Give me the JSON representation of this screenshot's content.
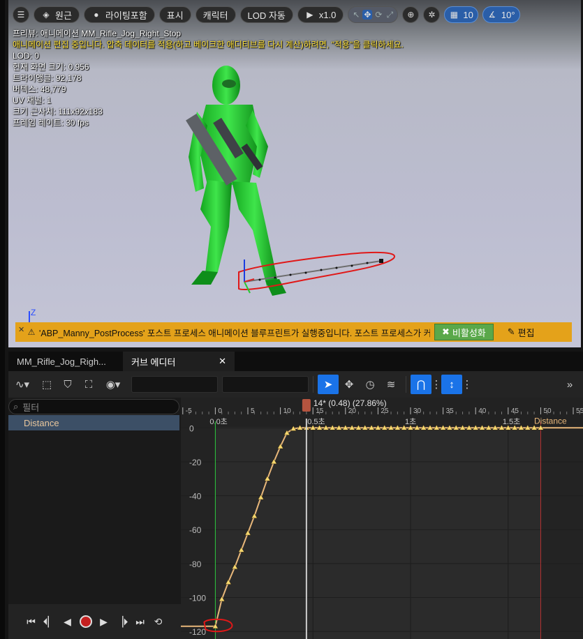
{
  "viewport": {
    "toolbar": {
      "menu_icon": "hamburger-icon",
      "perspective_label": "원근",
      "lighting_label": "라이팅포함",
      "show_label": "표시",
      "character_label": "캐릭터",
      "lod_label": "LOD 자동",
      "speed_label": "x1.0",
      "grid_value": "10",
      "angle_value": "10°"
    },
    "info": {
      "preview": "프리뷰: 애니메이션 MM_Rifle_Jog_Right_Stop",
      "editing_warning": "애니메이션 편집 중입니다. 압축 데이터를 적용(하고 베이크한 애디티브를 다시 계산)하려면, \"적용\"을 클릭하세요.",
      "lod": "LOD: 0",
      "screen_size": "현재 화면 크기: 0.956",
      "triangles": "트라이앵글: 92,178",
      "vertices": "버텍스: 48,779",
      "uv_channels": "UV 채널: 1",
      "approx_size": "크기 근사치: 111x92x183",
      "frame_rate": "프레임 레이트: 30 fps"
    },
    "axis_label": "Z",
    "warning_bar": {
      "close": "✕",
      "text": "'ABP_Manny_PostProcess' 포스트 프로세스 애니메이션 블루프린트가 실행중입니다. 포스트 프로세스가 커",
      "disable_label": "비활성화",
      "edit_label": "편집"
    }
  },
  "tabs": {
    "anim_tab": "MM_Rifle_Jog_Righ...",
    "curve_tab": "커브 에디터",
    "curve_close": "✕"
  },
  "left_panel": {
    "filter_placeholder": "필터",
    "curve_name": "Distance"
  },
  "colors": {
    "accent": "#1a73e8",
    "curve": "#e8b77a",
    "key": "#f5d76e",
    "playhead": "#cccccc",
    "start_marker": "#2ecc40",
    "end_marker": "#b83232",
    "warning": "#e4a21a",
    "annotation": "#e01818"
  },
  "chart_data": {
    "type": "line",
    "frame_ticks": [
      "-5",
      "0",
      "5",
      "10",
      "15",
      "20",
      "25",
      "30",
      "35",
      "40",
      "45",
      "50",
      "55"
    ],
    "time_labels": [
      "0.0초",
      "0.5초",
      "1초",
      "1.5초"
    ],
    "playhead_label": "14* (0.48) (27.86%)",
    "playhead_frame": 14,
    "y_ticks": [
      "0",
      "-20",
      "-40",
      "-60",
      "-80",
      "-100",
      "-120"
    ],
    "ylim": [
      -122,
      3
    ],
    "xlim_frames": [
      -5.3,
      56.5
    ],
    "start_frame": 0,
    "end_frame": 50,
    "series": [
      {
        "name": "Distance",
        "x": [
          0,
          1,
          2,
          3,
          4,
          5,
          6,
          7,
          8,
          9,
          10,
          11,
          12,
          13,
          14,
          15,
          16,
          17,
          18,
          19,
          20,
          21,
          22,
          23,
          24,
          25,
          26,
          27,
          28,
          29,
          30,
          31,
          32,
          33,
          34,
          35,
          36,
          37,
          38,
          39,
          40,
          41,
          42,
          43,
          44,
          45,
          46,
          47,
          48,
          49,
          50
        ],
        "y": [
          -117,
          -101,
          -91,
          -82,
          -72,
          -62,
          -52,
          -41,
          -30,
          -20,
          -11,
          -3,
          -0.5,
          0,
          0,
          0,
          0,
          0,
          0,
          0,
          0,
          0,
          0,
          0,
          0,
          0,
          0,
          0,
          0,
          0,
          0,
          0,
          0,
          0,
          0,
          0,
          0,
          0,
          0,
          0,
          0,
          0,
          0,
          0,
          0,
          0,
          0,
          0,
          0,
          0,
          0
        ]
      }
    ]
  }
}
